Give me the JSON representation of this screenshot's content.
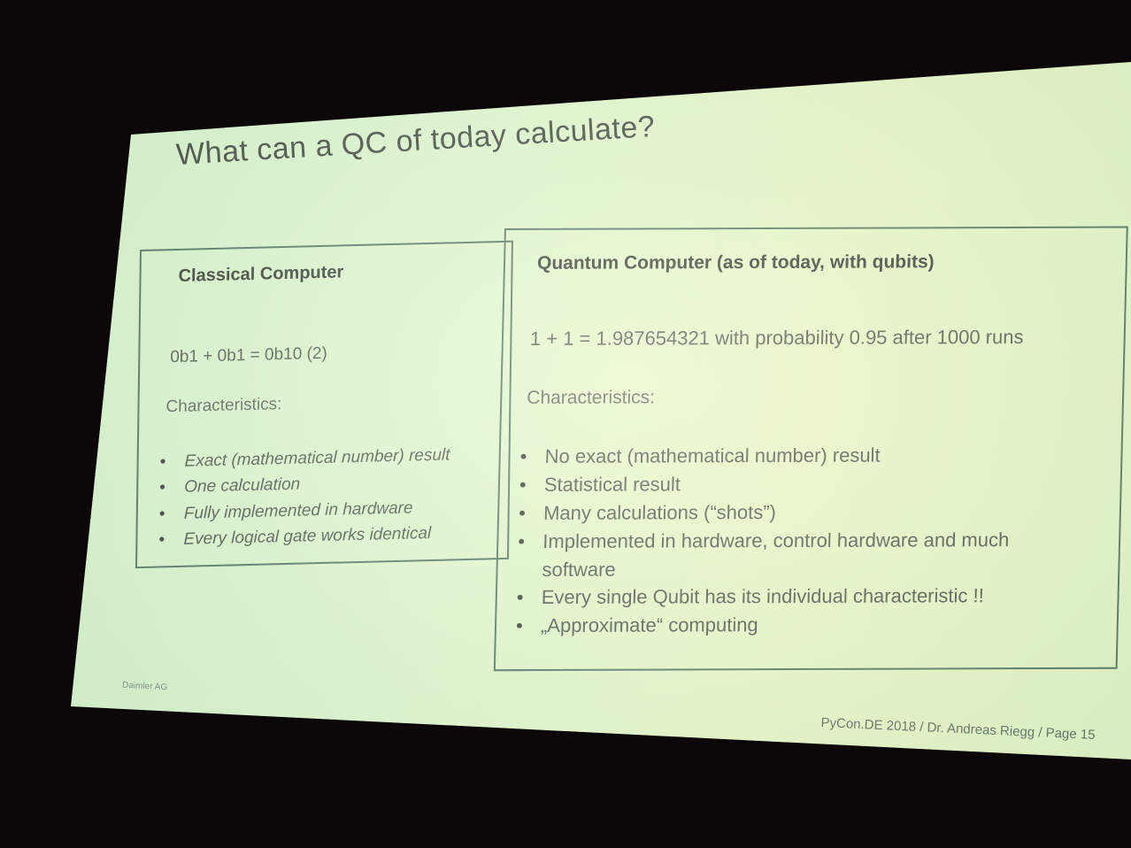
{
  "slide": {
    "title": "What can a QC of today calculate?",
    "classical": {
      "heading": "Classical Computer",
      "formula": "0b1 + 0b1 = 0b10 (2)",
      "characteristics_label": "Characteristics:",
      "items": [
        "Exact (mathematical number) result",
        "One calculation",
        "Fully implemented in hardware",
        "Every logical gate works identical"
      ]
    },
    "quantum": {
      "heading": "Quantum Computer (as of today, with qubits)",
      "formula": "1 + 1 = 1.987654321 with probability 0.95 after 1000 runs",
      "characteristics_label": "Characteristics:",
      "items": [
        "No exact (mathematical number) result",
        "Statistical result",
        "Many calculations (“shots”)",
        "Implemented in hardware, control hardware and much software",
        "Every single Qubit has its individual characteristic !!",
        "„Approximate“ computing"
      ]
    },
    "footer_left": "Daimler AG",
    "footer_right": "PyCon.DE 2018 / Dr. Andreas Riegg / Page 15"
  },
  "colors": {
    "slide_background": "#e0f7d2",
    "room_background": "#0b0709",
    "box_border": "#4f6f60",
    "text": "#4a4f4b"
  }
}
